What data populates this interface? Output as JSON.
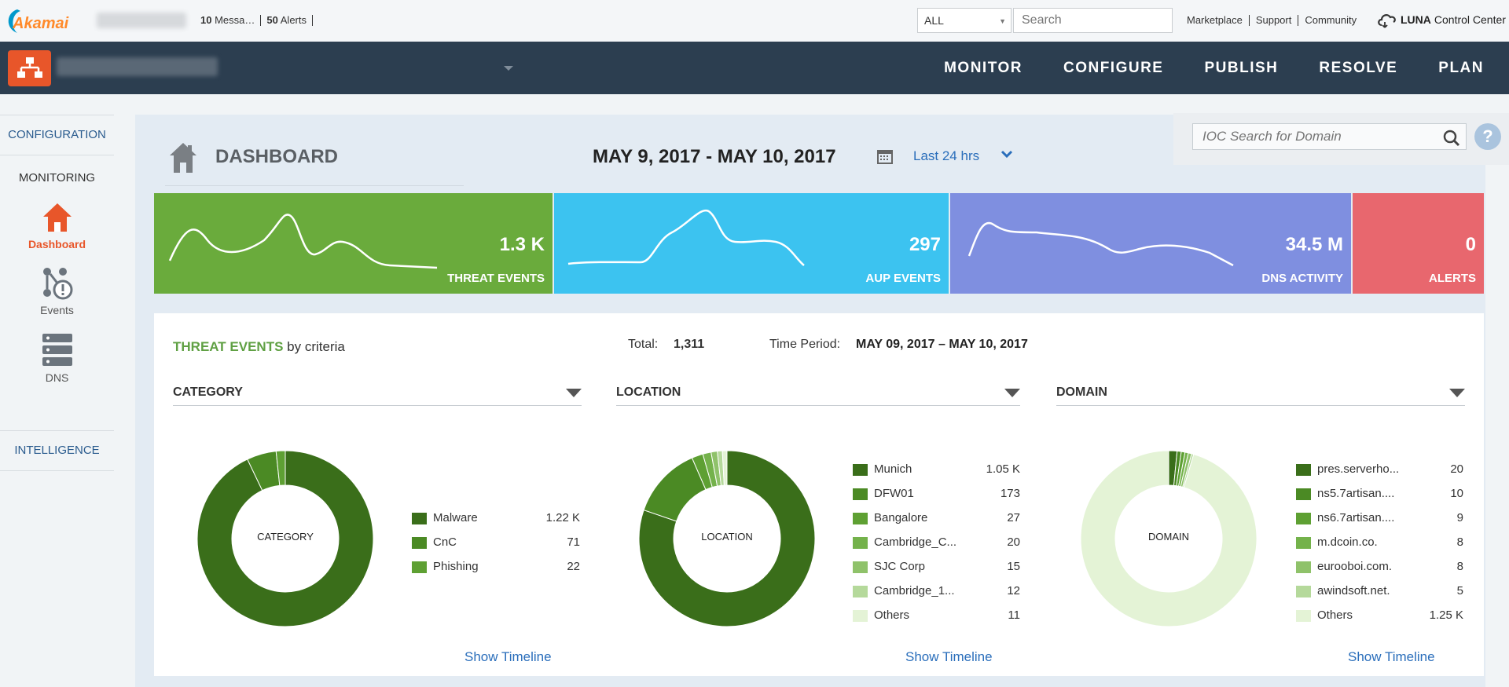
{
  "topbar": {
    "logo_text": "Akamai",
    "messages_count": "10",
    "messages_label": "Messa…",
    "alerts_count": "50",
    "alerts_label": "Alerts",
    "scope_select": "ALL",
    "search_placeholder": "Search",
    "links": [
      "Marketplace",
      "Support",
      "Community"
    ],
    "luna_bold": "LUNA",
    "luna_rest": "Control Center"
  },
  "nav": {
    "items": [
      "MONITOR",
      "CONFIGURE",
      "PUBLISH",
      "RESOLVE",
      "PLAN"
    ]
  },
  "sidebar": {
    "configuration": "CONFIGURATION",
    "monitoring": "MONITORING",
    "dashboard": "Dashboard",
    "events": "Events",
    "dns": "DNS",
    "intelligence": "INTELLIGENCE"
  },
  "header": {
    "title": "DASHBOARD",
    "date_range": "MAY 9, 2017 - MAY 10, 2017",
    "period": "Last 24 hrs",
    "ioc_placeholder": "IOC Search for Domain",
    "help": "?"
  },
  "tiles": [
    {
      "value": "1.3 K",
      "label": "THREAT EVENTS",
      "color": "#6aab3c"
    },
    {
      "value": "297",
      "label": "AUP EVENTS",
      "color": "#3cc3f0"
    },
    {
      "value": "34.5 M",
      "label": "DNS ACTIVITY",
      "color": "#7f8fe0"
    },
    {
      "value": "0",
      "label": "ALERTS",
      "color": "#e8676e"
    }
  ],
  "events": {
    "title_green": "THREAT EVENTS",
    "title_rest": "by criteria",
    "total_label": "Total:",
    "total": "1,311",
    "period_label": "Time Period:",
    "period": "MAY 09, 2017 – MAY 10, 2017",
    "show_timeline": "Show Timeline",
    "category": {
      "header": "CATEGORY",
      "center": "CATEGORY",
      "items": [
        {
          "name": "Malware",
          "value": "1.22 K",
          "n": 1220,
          "color": "#3a6e1a"
        },
        {
          "name": "CnC",
          "value": "71",
          "n": 71,
          "color": "#4b8a24"
        },
        {
          "name": "Phishing",
          "value": "22",
          "n": 22,
          "color": "#5ea033"
        }
      ]
    },
    "location": {
      "header": "LOCATION",
      "center": "LOCATION",
      "items": [
        {
          "name": "Munich",
          "value": "1.05 K",
          "n": 1050,
          "color": "#3a6e1a"
        },
        {
          "name": "DFW01",
          "value": "173",
          "n": 173,
          "color": "#4b8a24"
        },
        {
          "name": "Bangalore",
          "value": "27",
          "n": 27,
          "color": "#5ea033"
        },
        {
          "name": "Cambridge_C...",
          "value": "20",
          "n": 20,
          "color": "#74b24b"
        },
        {
          "name": "SJC Corp",
          "value": "15",
          "n": 15,
          "color": "#8fc26a"
        },
        {
          "name": "Cambridge_1...",
          "value": "12",
          "n": 12,
          "color": "#b5d99b"
        },
        {
          "name": "Others",
          "value": "11",
          "n": 11,
          "color": "#e4f3d6"
        }
      ]
    },
    "domain": {
      "header": "DOMAIN",
      "center": "DOMAIN",
      "items": [
        {
          "name": "pres.serverho...",
          "value": "20",
          "n": 20,
          "color": "#3a6e1a"
        },
        {
          "name": "ns5.7artisan....",
          "value": "10",
          "n": 10,
          "color": "#4b8a24"
        },
        {
          "name": "ns6.7artisan....",
          "value": "9",
          "n": 9,
          "color": "#5ea033"
        },
        {
          "name": "m.dcoin.co.",
          "value": "8",
          "n": 8,
          "color": "#74b24b"
        },
        {
          "name": "eurooboi.com.",
          "value": "8",
          "n": 8,
          "color": "#8fc26a"
        },
        {
          "name": "awindsoft.net.",
          "value": "5",
          "n": 5,
          "color": "#b5d99b"
        },
        {
          "name": "Others",
          "value": "1.25 K",
          "n": 1250,
          "color": "#e4f3d6"
        }
      ]
    }
  }
}
